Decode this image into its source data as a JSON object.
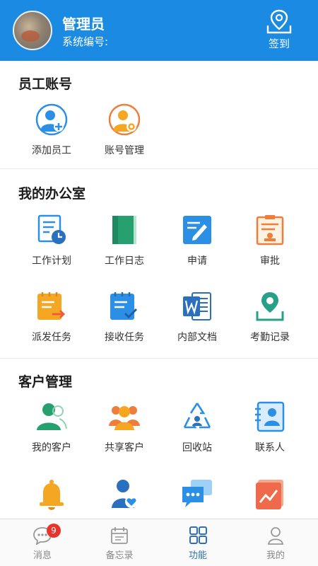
{
  "header": {
    "name": "管理员",
    "code_label": "系统编号:",
    "checkin_label": "签到"
  },
  "sections": {
    "staff": {
      "title": "员工账号",
      "items": [
        {
          "label": "添加员工"
        },
        {
          "label": "账号管理"
        }
      ]
    },
    "office": {
      "title": "我的办公室",
      "items": [
        {
          "label": "工作计划"
        },
        {
          "label": "工作日志"
        },
        {
          "label": "申请"
        },
        {
          "label": "审批"
        },
        {
          "label": "派发任务"
        },
        {
          "label": "接收任务"
        },
        {
          "label": "内部文档"
        },
        {
          "label": "考勤记录"
        }
      ]
    },
    "customers": {
      "title": "客户管理",
      "items": [
        {
          "label": "我的客户"
        },
        {
          "label": "共享客户"
        },
        {
          "label": "回收站"
        },
        {
          "label": "联系人"
        }
      ]
    }
  },
  "tabbar": {
    "items": [
      {
        "label": "消息",
        "badge": "9"
      },
      {
        "label": "备忘录"
      },
      {
        "label": "功能"
      },
      {
        "label": "我的"
      }
    ],
    "active_index": 2
  },
  "colors": {
    "brand": "#1a8ae3",
    "tab_active": "#2e6fb5",
    "badge": "#e8352b"
  }
}
